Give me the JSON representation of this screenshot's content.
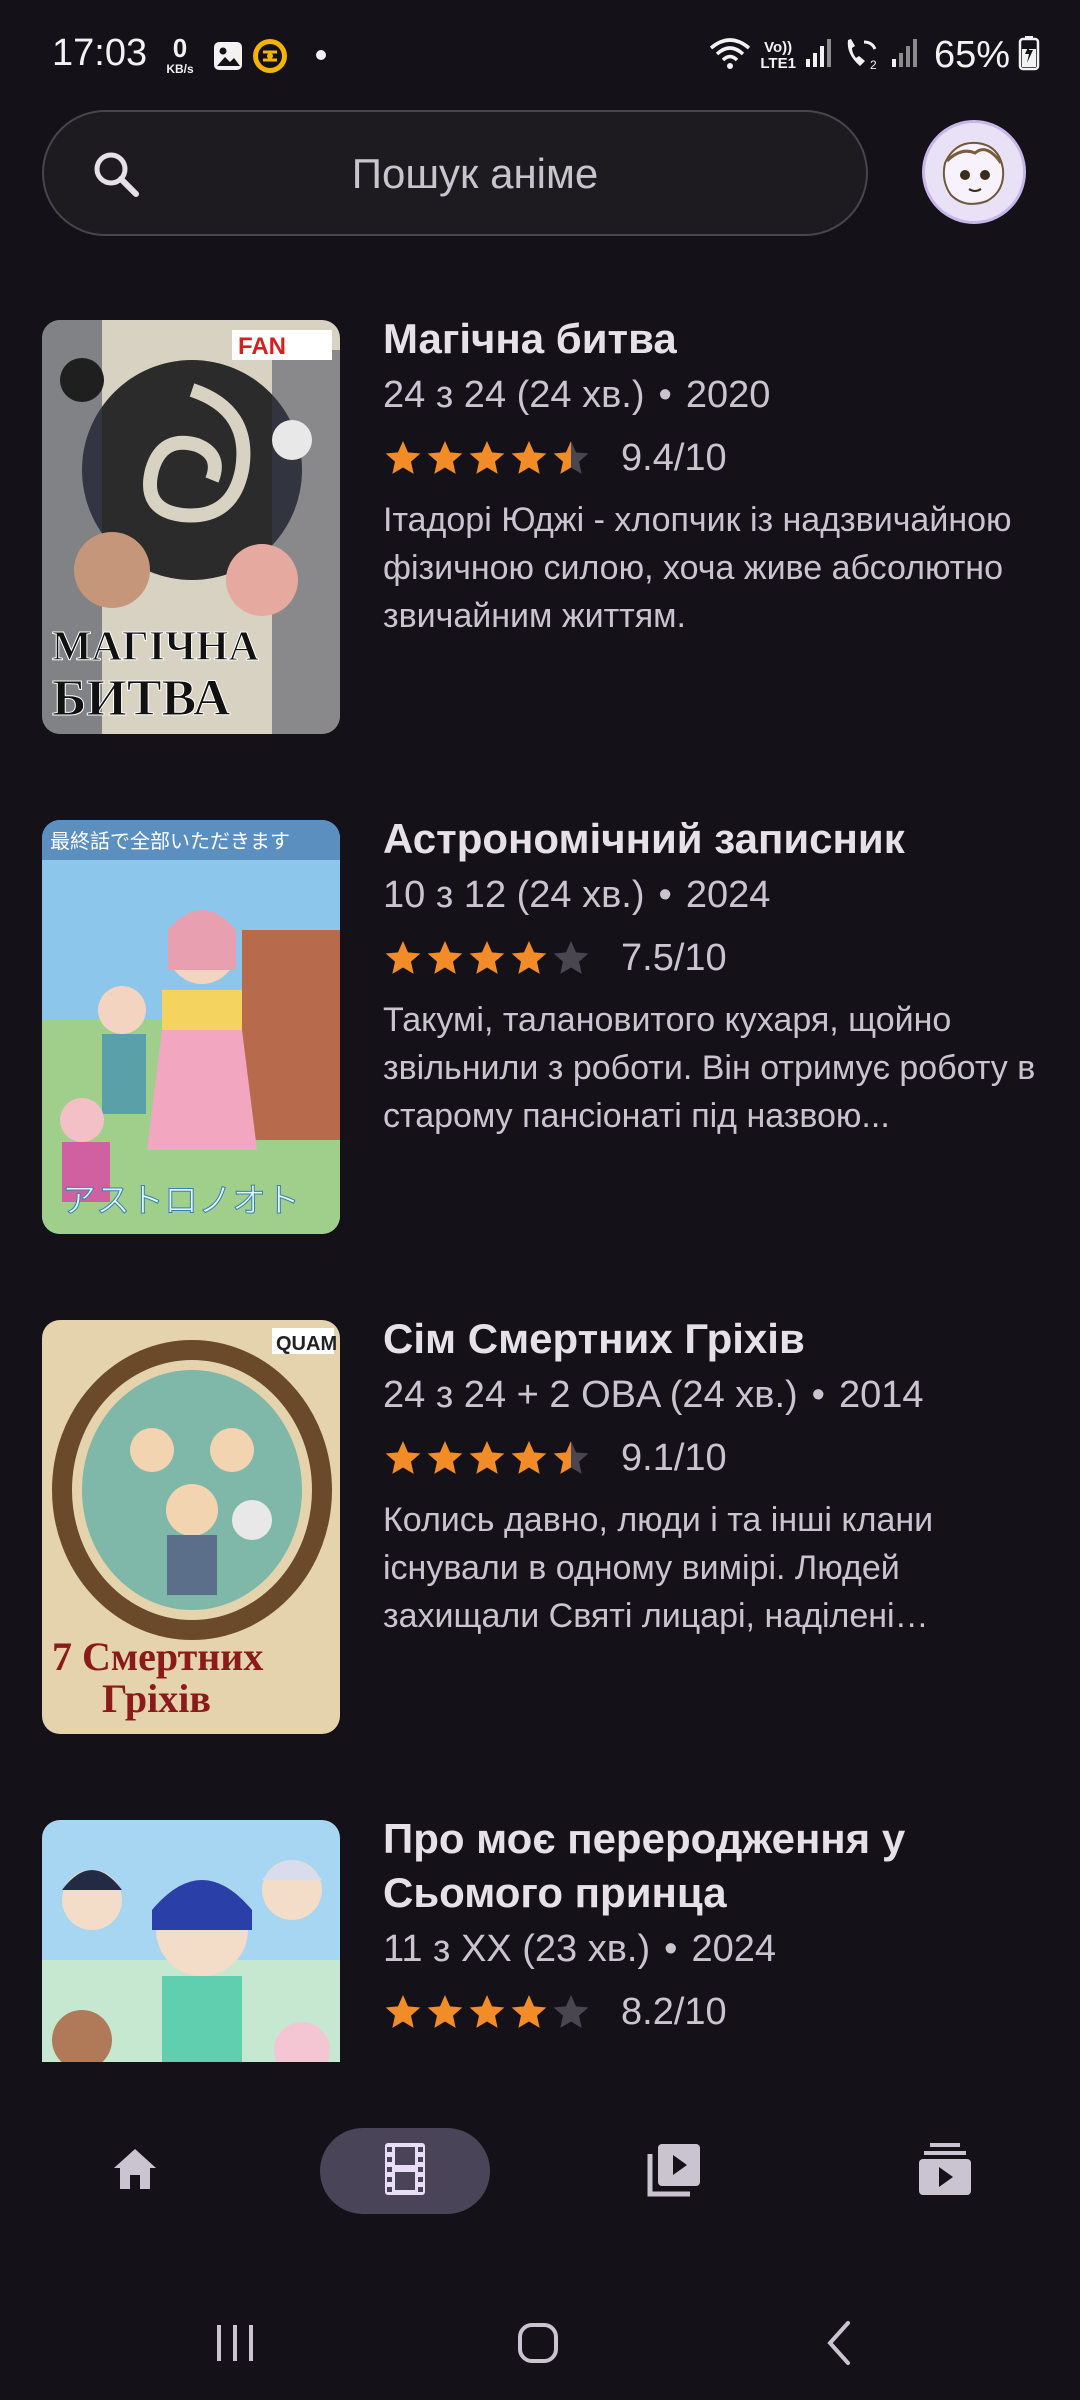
{
  "status_bar": {
    "time": "17:03",
    "net_speed_value": "0",
    "net_speed_unit": "KB/s",
    "volte_line1": "Vo))",
    "volte_line2": "LTE1",
    "battery_percent": "65%"
  },
  "search": {
    "placeholder": "Пошук аніме",
    "icon": "search-icon"
  },
  "colors": {
    "accent": "#f28c28",
    "background": "#141218",
    "active_nav_pill": "#4a4458"
  },
  "anime": [
    {
      "title": "Магічна битва",
      "episodes": "24 з 24 (24 хв.)",
      "year": "2020",
      "stars": 4.5,
      "rating": "9.4/10",
      "description": "Ітадорі Юджі - хлопчик із надзвичайною фізичною силою, хоча живе абсолютно звичайним життям.",
      "poster_text_1": "МАГІЧНА",
      "poster_text_2": "БИТВА",
      "poster_badge": "FAN"
    },
    {
      "title": "Астрономічний записник",
      "episodes": "10 з 12 (24 хв.)",
      "year": "2024",
      "stars": 4,
      "rating": "7.5/10",
      "description": "Такумі, талановитого кухаря, щойно звільнили з роботи. Він отримує роботу в старому пансіонаті під назвою...",
      "poster_text_1": "最終話で全部いただきます",
      "poster_text_2": "アストロノオト",
      "poster_badge": ""
    },
    {
      "title": "Сім Смертних Гріхів",
      "episodes": "24 з 24 + 2 OBA (24 хв.)",
      "year": "2014",
      "stars": 4.5,
      "rating": "9.1/10",
      "description": "Колись давно, люди і та інші клани існували в одному вимірі. Людей захищали Святі лицарі, наділені могутньою силою.",
      "poster_text_1": "7 Смертних",
      "poster_text_2": "Гріхів",
      "poster_badge": "QUAM"
    },
    {
      "title": "Про моє переродження у Сьомого принца",
      "episodes": "11 з XX (23 хв.)",
      "year": "2024",
      "stars": 4,
      "rating": "8.2/10",
      "description": "",
      "poster_text_1": "",
      "poster_text_2": "",
      "poster_badge": ""
    }
  ],
  "bottom_nav": [
    {
      "icon": "home-icon",
      "active": false
    },
    {
      "icon": "film-icon",
      "active": true
    },
    {
      "icon": "video-library-icon",
      "active": false
    },
    {
      "icon": "subscriptions-icon",
      "active": false
    }
  ]
}
